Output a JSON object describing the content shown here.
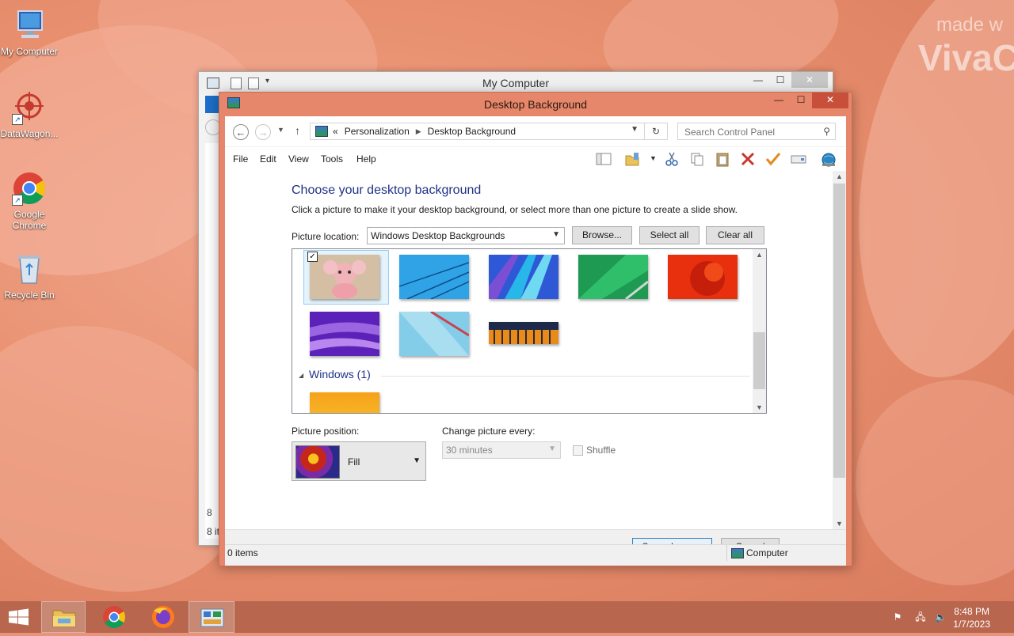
{
  "desktop": {
    "watermark": {
      "line1": "made w",
      "line2": "VivaC"
    },
    "icons": [
      {
        "label": "My Computer",
        "icon": "computer-icon"
      },
      {
        "label": "DataWagon...",
        "icon": "datawagon-icon"
      },
      {
        "label": "Google Chrome",
        "icon": "chrome-icon"
      },
      {
        "label": "Recycle Bin",
        "icon": "recycle-bin-icon"
      }
    ]
  },
  "back_window": {
    "title": "My Computer",
    "status_fragment": "8 it",
    "side_fragment": "8"
  },
  "window": {
    "title": "Desktop Background",
    "address": {
      "prefix": "«",
      "crumbs": [
        "Personalization",
        "Desktop Background"
      ]
    },
    "search": {
      "placeholder": "Search Control Panel"
    },
    "menu": [
      "File",
      "Edit",
      "View",
      "Tools",
      "Help"
    ],
    "heading": "Choose your desktop background",
    "subtext": "Click a picture to make it your desktop background, or select more than one picture to create a slide show.",
    "picture_location": {
      "label": "Picture location:",
      "value": "Windows Desktop Backgrounds",
      "browse": "Browse...",
      "select_all": "Select all",
      "clear_all": "Clear all"
    },
    "gallery": {
      "group_label": "Windows (1)"
    },
    "picture_position": {
      "label": "Picture position:",
      "value": "Fill"
    },
    "change_picture": {
      "label": "Change picture every:",
      "value": "30 minutes"
    },
    "shuffle_label": "Shuffle",
    "save_button": "Save changes",
    "cancel_button": "Cancel",
    "status": {
      "items": "0 items",
      "location": "Computer"
    }
  },
  "taskbar": {
    "time": "8:48 PM",
    "date": "1/7/2023"
  }
}
